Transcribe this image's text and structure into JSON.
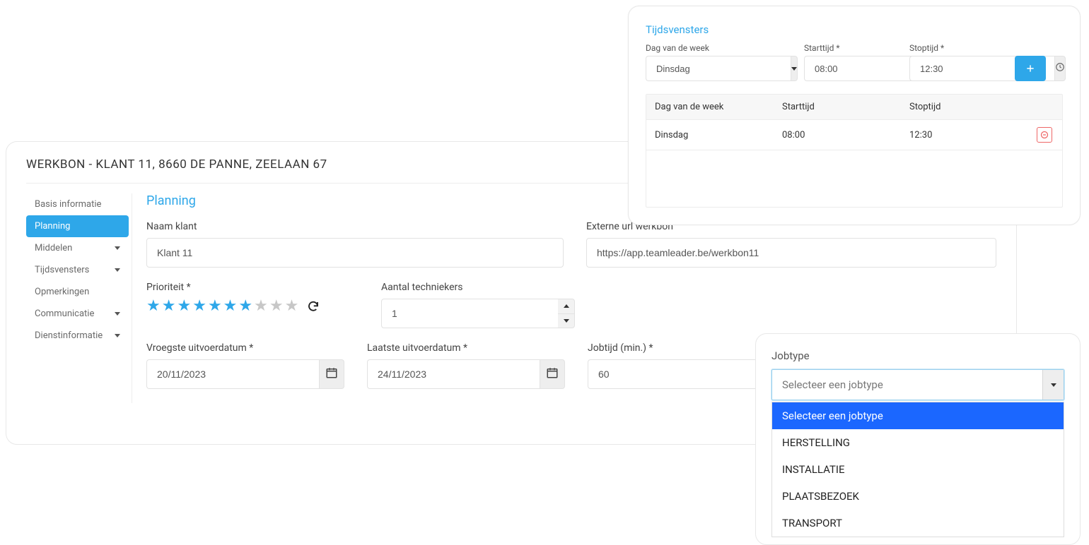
{
  "werkbon": {
    "title": "WERKBON - KLANT 11, 8660 DE PANNE, ZEELAAN 67"
  },
  "sidenav": {
    "items": [
      {
        "label": "Basis informatie",
        "active": false,
        "expandable": false
      },
      {
        "label": "Planning",
        "active": true,
        "expandable": false
      },
      {
        "label": "Middelen",
        "active": false,
        "expandable": true
      },
      {
        "label": "Tijdsvensters",
        "active": false,
        "expandable": true
      },
      {
        "label": "Opmerkingen",
        "active": false,
        "expandable": false
      },
      {
        "label": "Communicatie",
        "active": false,
        "expandable": true
      },
      {
        "label": "Dienstinformatie",
        "active": false,
        "expandable": true
      }
    ]
  },
  "planning": {
    "heading": "Planning",
    "naam_klant_label": "Naam klant",
    "naam_klant_value": "Klant 11",
    "externe_url_label": "Externe url werkbon",
    "externe_url_value": "https://app.teamleader.be/werkbon11",
    "prioriteit_label": "Prioriteit *",
    "prioriteit_filled": 7,
    "prioriteit_total": 10,
    "aantal_tech_label": "Aantal techniekers",
    "aantal_tech_value": "1",
    "vroegste_label": "Vroegste uitvoerdatum *",
    "vroegste_value": "20/11/2023",
    "laatste_label": "Laatste uitvoerdatum *",
    "laatste_value": "24/11/2023",
    "jobtijd_label": "Jobtijd (min.) *",
    "jobtijd_value": "60"
  },
  "tijdsvensters": {
    "heading": "Tijdsvensters",
    "dag_label": "Dag van de week",
    "dag_value": "Dinsdag",
    "start_label": "Starttijd *",
    "start_value": "08:00",
    "stop_label": "Stoptijd *",
    "stop_value": "12:30",
    "table": {
      "headers": {
        "dag": "Dag van de week",
        "start": "Starttijd",
        "stop": "Stoptijd"
      },
      "rows": [
        {
          "dag": "Dinsdag",
          "start": "08:00",
          "stop": "12:30"
        }
      ]
    }
  },
  "jobtype": {
    "label": "Jobtype",
    "placeholder": "Selecteer een jobtype",
    "options": [
      "Selecteer een jobtype",
      "HERSTELLING",
      "INSTALLATIE",
      "PLAATSBEZOEK",
      "TRANSPORT"
    ],
    "selected_index": 0
  }
}
